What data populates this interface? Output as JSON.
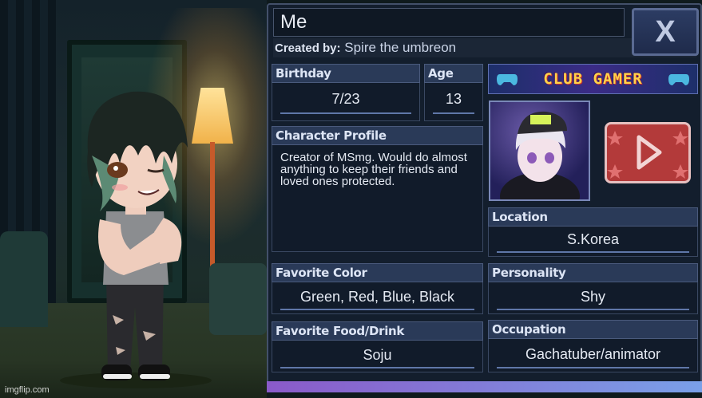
{
  "profile": {
    "name": "Me",
    "created_by_label": "Created by:",
    "created_by": "Spire the umbreon",
    "close_label": "X",
    "birthday": {
      "label": "Birthday",
      "value": "7/23"
    },
    "age": {
      "label": "Age",
      "value": "13"
    },
    "character_profile": {
      "label": "Character Profile",
      "value": "Creator of MSmg. Would do almost anything to keep their friends and loved ones protected."
    },
    "location": {
      "label": "Location",
      "value": "S.Korea"
    },
    "favorite_color": {
      "label": "Favorite Color",
      "value": "Green, Red, Blue, Black"
    },
    "personality": {
      "label": "Personality",
      "value": "Shy"
    },
    "favorite_food": {
      "label": "Favorite Food/Drink",
      "value": "Soju"
    },
    "occupation": {
      "label": "Occupation",
      "value": "Gachatuber/animator"
    }
  },
  "banner": {
    "text": "CLUB GAMER",
    "icon": "gamepad-icon"
  },
  "avatar": {
    "icon": "avatar-portrait"
  },
  "play_button": {
    "icon": "play-icon"
  },
  "watermark": "imgflip.com",
  "colors": {
    "panel_bg": "#131e2d",
    "header_bg": "#2a3a58",
    "underline": "#5f77a8",
    "play_red": "#b33a3a",
    "footer_gradient_start": "#8a5ac9",
    "footer_gradient_end": "#7aa0e8"
  }
}
